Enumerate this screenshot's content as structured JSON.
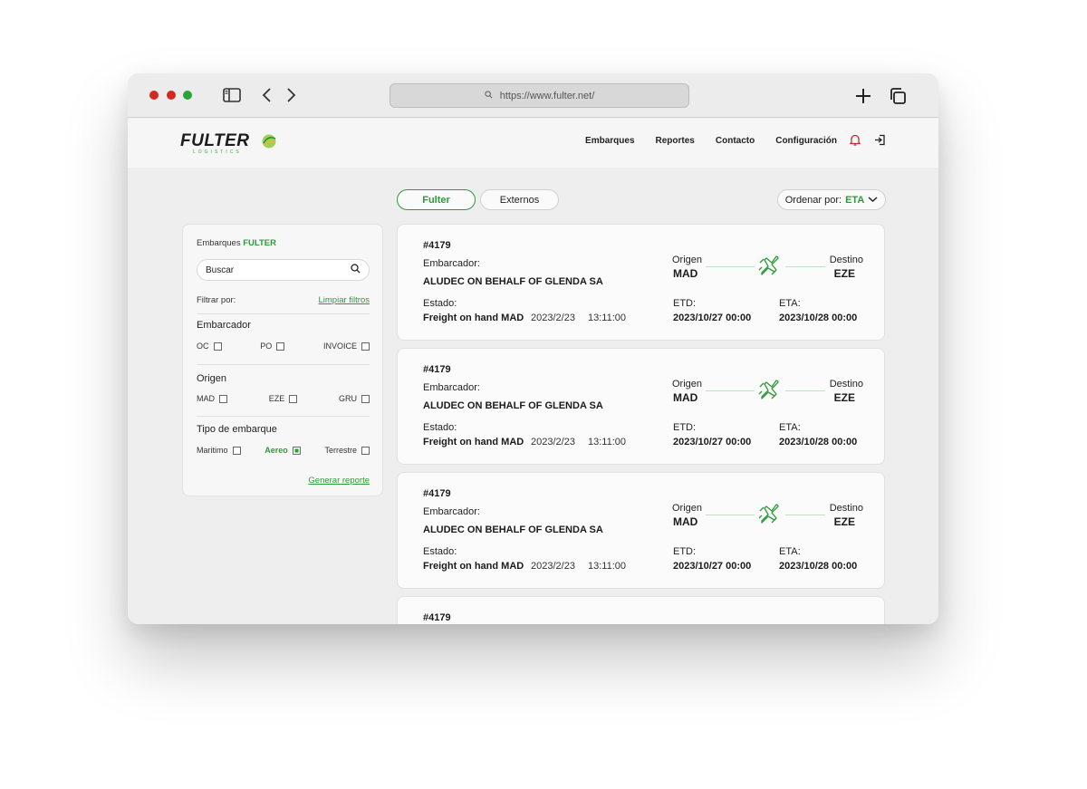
{
  "browser": {
    "url": "https://www.fulter.net/"
  },
  "brand": {
    "name": "FULTER",
    "sub": "LOGISTICS",
    "accent": "#2e9a3a"
  },
  "nav": {
    "items": [
      "Embarques",
      "Reportes",
      "Contacto",
      "Configuración"
    ],
    "icons": [
      "bell-icon",
      "logout-icon"
    ]
  },
  "tabs": [
    {
      "label": "Fulter",
      "active": true
    },
    {
      "label": "Externos",
      "active": false
    }
  ],
  "sort": {
    "label": "Ordenar por:",
    "value": "ETA"
  },
  "filters": {
    "title_prefix": "Embarques",
    "title_brand": "FULTER",
    "search_placeholder": "Buscar",
    "filter_label": "Filtrar por:",
    "clear_label": "Limpiar filtros",
    "groups": [
      {
        "title": "Embarcador",
        "options": [
          {
            "label": "OC",
            "checked": false
          },
          {
            "label": "PO",
            "checked": false
          },
          {
            "label": "INVOICE",
            "checked": false
          }
        ]
      },
      {
        "title": "Origen",
        "options": [
          {
            "label": "MAD",
            "checked": false
          },
          {
            "label": "EZE",
            "checked": false
          },
          {
            "label": "GRU",
            "checked": false
          }
        ]
      },
      {
        "title": "Tipo de embarque",
        "options": [
          {
            "label": "Maritimo",
            "checked": false
          },
          {
            "label": "Aereo",
            "checked": true
          },
          {
            "label": "Terrestre",
            "checked": false
          }
        ]
      }
    ],
    "report_label": "Generar reporte"
  },
  "labels": {
    "embarcador": "Embarcador:",
    "estado": "Estado:",
    "origen": "Origen",
    "destino": "Destino",
    "etd": "ETD:",
    "eta": "ETA:"
  },
  "shipments": [
    {
      "id": "#4179",
      "shipper": "ALUDEC ON BEHALF OF GLENDA SA",
      "status": "Freight on hand MAD",
      "status_date": "2023/2/23",
      "status_time": "13:11:00",
      "origin": "MAD",
      "destination": "EZE",
      "etd": "2023/10/27 00:00",
      "eta": "2023/10/28 00:00"
    },
    {
      "id": "#4179",
      "shipper": "ALUDEC ON BEHALF OF GLENDA SA",
      "status": "Freight on hand MAD",
      "status_date": "2023/2/23",
      "status_time": "13:11:00",
      "origin": "MAD",
      "destination": "EZE",
      "etd": "2023/10/27 00:00",
      "eta": "2023/10/28 00:00"
    },
    {
      "id": "#4179",
      "shipper": "ALUDEC ON BEHALF OF GLENDA SA",
      "status": "Freight on hand MAD",
      "status_date": "2023/2/23",
      "status_time": "13:11:00",
      "origin": "MAD",
      "destination": "EZE",
      "etd": "2023/10/27 00:00",
      "eta": "2023/10/28 00:00"
    },
    {
      "id": "#4179"
    }
  ]
}
